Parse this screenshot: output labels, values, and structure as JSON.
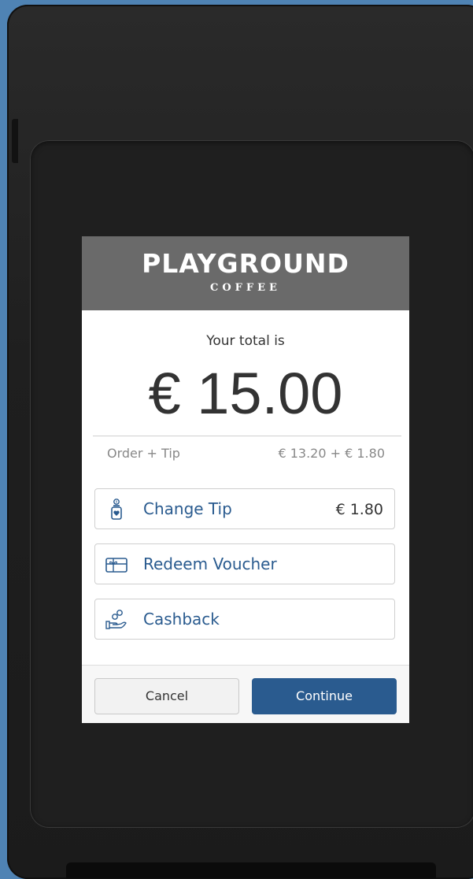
{
  "brand": {
    "name": "PLAYGROUND",
    "subtitle": "COFFEE"
  },
  "summary": {
    "label": "Your total is",
    "total": "€ 15.00",
    "breakdown_label": "Order + Tip",
    "breakdown_value": "€ 13.20 + € 1.80"
  },
  "options": {
    "tip": {
      "label": "Change Tip",
      "value": "€ 1.80",
      "icon": "tip-jar-icon"
    },
    "voucher": {
      "label": "Redeem Voucher",
      "icon": "gift-card-icon"
    },
    "cashback": {
      "label": "Cashback",
      "icon": "hand-coins-icon"
    }
  },
  "footer": {
    "cancel_label": "Cancel",
    "continue_label": "Continue"
  },
  "colors": {
    "accent": "#2a5b8f",
    "header_bg": "#6a6a6a",
    "background": "#4f83b4"
  }
}
